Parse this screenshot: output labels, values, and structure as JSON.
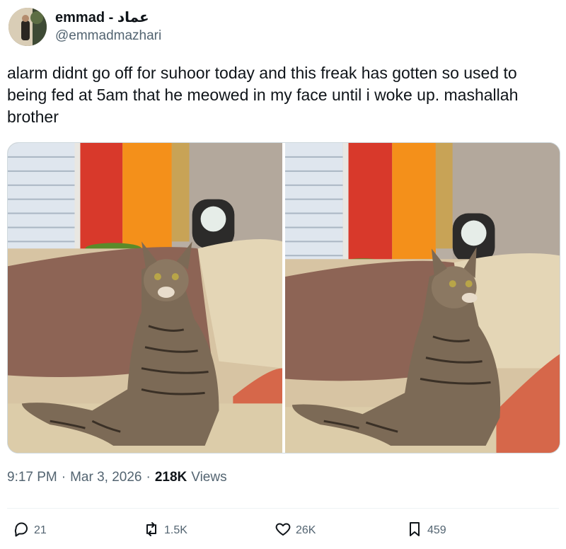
{
  "author": {
    "display_name": "emmad - عماد",
    "handle": "@emmadmazhari"
  },
  "tweet": {
    "text": "alarm didnt go off for suhoor today and this freak has gotten so used to being fed at 5am that he meowed in my face until i woke up. mashallah brother"
  },
  "meta": {
    "time": "9:17 PM",
    "separator": "·",
    "date": "Mar 3, 2026",
    "views_count": "218K",
    "views_label": "Views"
  },
  "actions": {
    "replies": "21",
    "retweets": "1.5K",
    "likes": "26K",
    "bookmarks": "459"
  },
  "icons": [
    "reply-icon",
    "retweet-icon",
    "like-icon",
    "bookmark-icon"
  ],
  "colors": {
    "text": "#0f1419",
    "secondary": "#536471"
  }
}
